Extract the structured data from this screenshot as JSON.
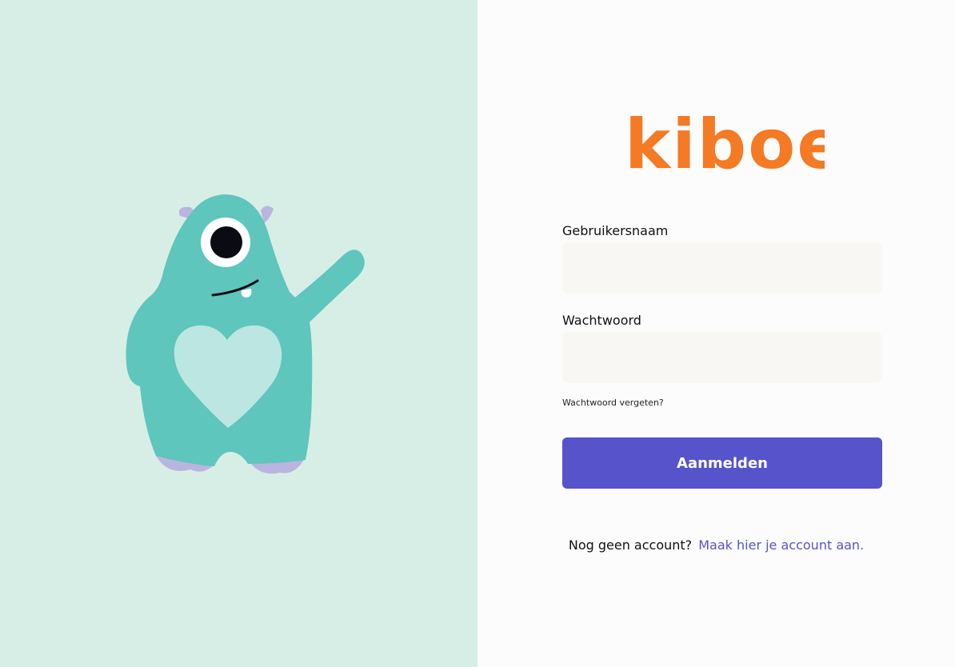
{
  "brand": {
    "logo_text": "kiboe",
    "logo_color": "#f47a24"
  },
  "mascot": {
    "icon": "one-eyed-monster-waving-icon",
    "body_color": "#5ec6bc",
    "heart_color": "#bce6e2",
    "horn_color": "#b9b5df"
  },
  "form": {
    "username_label": "Gebruikersnaam",
    "username_value": "",
    "password_label": "Wachtwoord",
    "password_value": "",
    "forgot_link": "Wachtwoord vergeten?",
    "submit_label": "Aanmelden"
  },
  "signup": {
    "prompt": "Nog geen account?",
    "link": "Maak hier je account aan."
  },
  "colors": {
    "left_background": "#d7eee7",
    "right_background": "#fcfcfc",
    "input_background": "#f8f7f3",
    "accent": "#5653cb"
  }
}
